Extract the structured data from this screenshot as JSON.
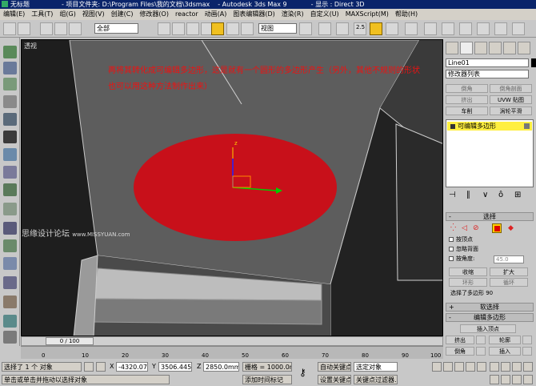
{
  "titlebar": {
    "app_title": "无标题",
    "project": "- 项目文件夹: D:\\Program Files\\我的文档\\3dsmax",
    "product": "- Autodesk 3ds Max 9",
    "display": "- 显示 : Direct 3D"
  },
  "menu": [
    "编辑(E)",
    "工具(T)",
    "组(G)",
    "视图(V)",
    "创建(C)",
    "修改器(O)",
    "reactor",
    "动画(A)",
    "图表编辑器(D)",
    "渲染(R)",
    "自定义(U)",
    "MAXScript(M)",
    "帮助(H)"
  ],
  "toolbar": {
    "selection_filter": "全部",
    "ref_coord": "视图",
    "snap_label": "2.5"
  },
  "viewport": {
    "label": "透视",
    "annotation_line1": "再将其转化成可编辑多边形，这是就有一个圆形的多边形产生（另外，其他不规则的形状",
    "annotation_line2": "也可以用这种方法制作出来）",
    "watermark": "思缘设计论坛",
    "watermark_url": "www.MISSYUAN.com",
    "gizmo_label": "z"
  },
  "panel": {
    "object_name": "Line01",
    "modifier_list": "修改器列表",
    "buttons": [
      {
        "label": "倒角",
        "enabled": false
      },
      {
        "label": "倒角剖面",
        "enabled": false
      },
      {
        "label": "挤出",
        "enabled": false
      },
      {
        "label": "UVW 贴图",
        "enabled": true
      },
      {
        "label": "车削",
        "enabled": true
      },
      {
        "label": "涡轮平滑",
        "enabled": true
      }
    ],
    "stack_item": "可编辑多边形",
    "selection_rollout": "选择",
    "by_vertex": "按顶点",
    "ignore_backfacing": "忽略背面",
    "by_angle": "按角度:",
    "angle_value": "45.0",
    "shrink": "收缩",
    "grow": "扩大",
    "ring": "环形",
    "loop": "循环",
    "selection_status": "选择了多边形 90",
    "soft_selection": "软选择",
    "edit_polygons": "编辑多边形",
    "insert_vertex": "插入顶点",
    "extrude": "挤出",
    "outline": "轮廓",
    "bevel": "倒角",
    "inset": "插入"
  },
  "timeline": {
    "frame": "0 / 100",
    "ticks": [
      "0",
      "10",
      "20",
      "30",
      "40",
      "50",
      "60",
      "70",
      "80",
      "90",
      "100"
    ]
  },
  "status": {
    "selected": "选择了 1 个 对象",
    "x_value": "-4320.075",
    "y_value": "3506.445m",
    "z_value": "2850.0mm",
    "grid": "栅格 = 1000.0mm",
    "auto_key": "自动关键点",
    "auto_key_sel": "选定对象",
    "set_key": "设置关键点",
    "key_filter": "关键点过滤器...",
    "prompt": "单击或单击并拖动以选择对象",
    "add_time_tag": "添加时间标记"
  },
  "colors": {
    "accent_yellow": "#ffef40",
    "circle_red": "#c8101a",
    "annotation_red": "#ee1111"
  }
}
